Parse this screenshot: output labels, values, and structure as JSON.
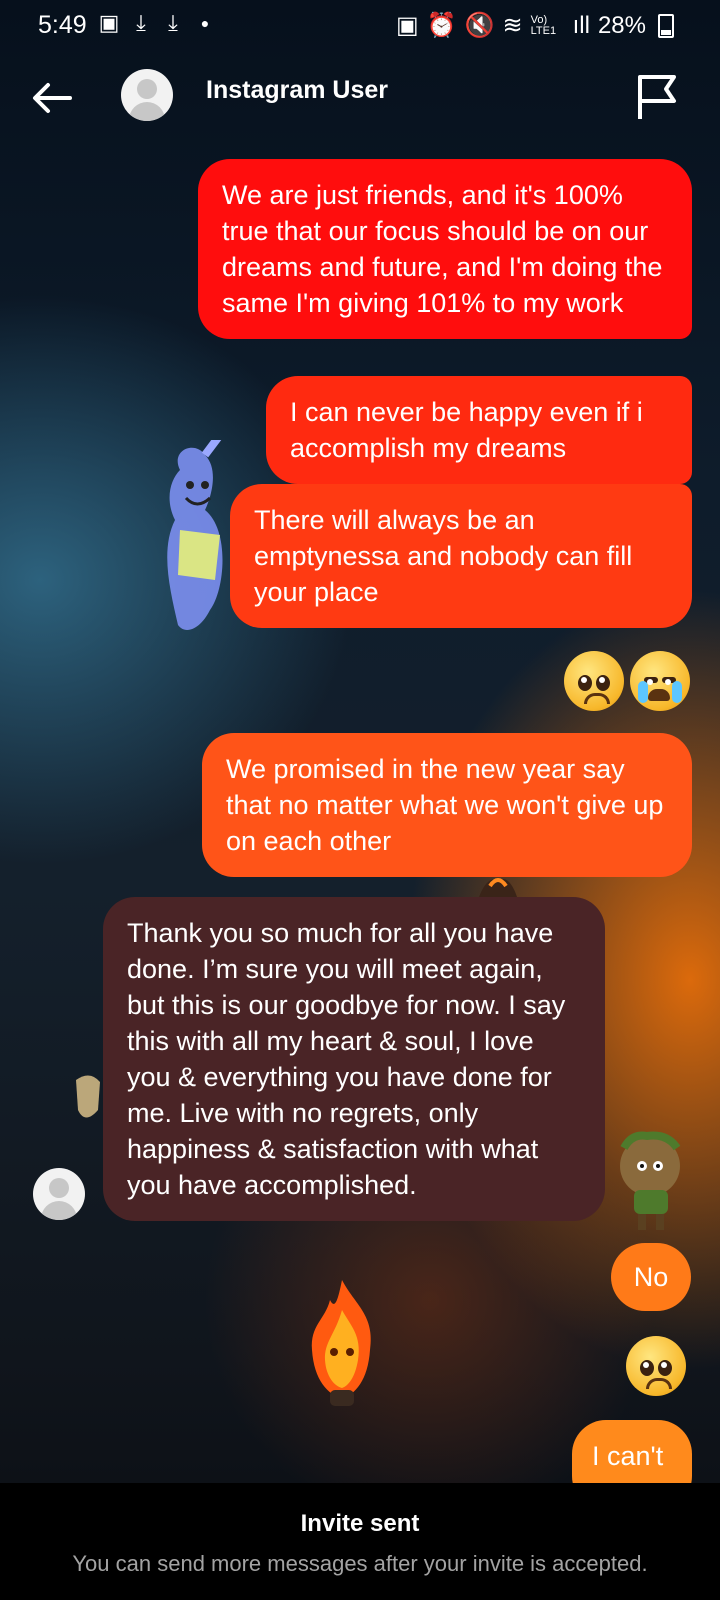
{
  "status_bar": {
    "time": "5:49",
    "battery": "28%",
    "network": "Vo) LTE1",
    "left_icons": [
      "gallery-icon",
      "download-icon",
      "download-icon",
      "dot-icon"
    ],
    "right_icons": [
      "battery-saver-icon",
      "alarm-icon",
      "mute-icon",
      "wifi-icon",
      "signal-icon"
    ]
  },
  "header": {
    "title": "Instagram User",
    "back_icon": "arrow-left-icon",
    "report_icon": "flag-icon"
  },
  "messages": [
    {
      "sender": "me",
      "text": "We are just friends, and it's 100% true that our focus should be on our dreams and future, and I'm doing the same I'm giving 101% to my work",
      "color": "#ff0d0d"
    },
    {
      "sender": "me",
      "text": "I can never be happy even if i accomplish my dreams",
      "color": "#ff2a10"
    },
    {
      "sender": "me",
      "text": "There will always be an emptynessa and nobody can fill your place",
      "color": "#ff3a12"
    },
    {
      "sender": "me",
      "type": "emoji",
      "emojis": [
        "pleading-face-emoji",
        "crying-face-emoji"
      ]
    },
    {
      "sender": "me",
      "text": "We promised in the new year say that no matter what we won't give up on each other",
      "color": "#ff5418"
    },
    {
      "sender": "them",
      "text": "Thank you so much for all you have done. I’m sure you will meet again, but this is our goodbye for now. I say this with all my heart & soul, I love you & everything you have done for me. Live with no regrets, only happiness & satisfaction with what you have accomplished.",
      "color": "#4a2426"
    },
    {
      "sender": "me",
      "text": "No",
      "color": "#ff7a18"
    },
    {
      "sender": "me",
      "type": "emoji",
      "emojis": [
        "pleading-face-emoji"
      ]
    },
    {
      "sender": "me",
      "text": "I can't",
      "color": "#ff8a1c",
      "partially_hidden": true
    }
  ],
  "footer": {
    "title": "Invite sent",
    "subtitle": "You can send more messages after your invite is accepted."
  }
}
